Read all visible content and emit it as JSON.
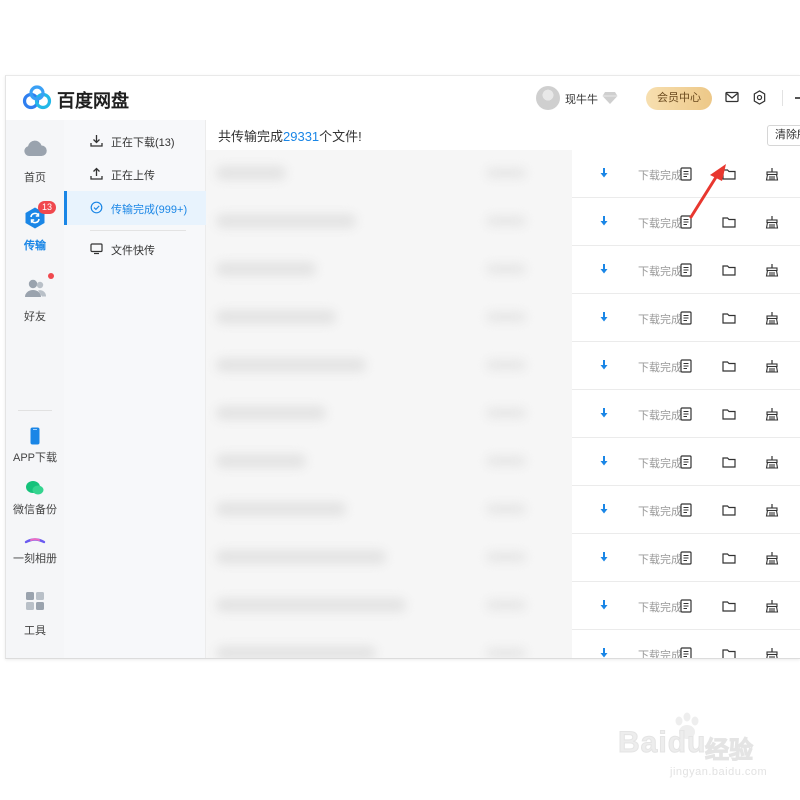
{
  "app": {
    "title": "百度网盘",
    "username": "现牛牛",
    "vip_button": "会员中心",
    "colors": {
      "accent": "#1a86e6",
      "badge": "#f0484e",
      "vip_gold": "#edc888"
    }
  },
  "nav": {
    "home": "首页",
    "transfer": "传输",
    "transfer_badge": "13",
    "friends": "好友",
    "app_download": "APP下载",
    "wechat_backup": "微信备份",
    "album": "一刻相册",
    "tools": "工具"
  },
  "subnav": {
    "downloading": "正在下载(13)",
    "uploading": "正在上传",
    "completed": "传输完成(999+)",
    "quick_send": "文件快传"
  },
  "main": {
    "summary_prefix": "共传输完成",
    "summary_count": "29331",
    "summary_suffix": "个文件!",
    "clear_button": "清除所",
    "rows": [
      {
        "status": "下载完成"
      },
      {
        "status": "下载完成"
      },
      {
        "status": "下载完成"
      },
      {
        "status": "下载完成"
      },
      {
        "status": "下载完成"
      },
      {
        "status": "下载完成"
      },
      {
        "status": "下载完成"
      },
      {
        "status": "下载完成"
      },
      {
        "status": "下载完成"
      },
      {
        "status": "下载完成"
      },
      {
        "status": "下载完成"
      }
    ]
  },
  "watermark": {
    "brand": "Bai",
    "brand2": "du",
    "jingyan": "经验",
    "url": "jingyan.baidu.com"
  },
  "icons": [
    "cloud-logo-icon",
    "home-cloud-icon",
    "transfer-icon",
    "friends-icon",
    "phone-icon",
    "wechat-icon",
    "album-icon",
    "tools-grid-icon",
    "download-icon",
    "upload-icon",
    "check-circle-icon",
    "monitor-icon",
    "doc-icon",
    "folder-icon",
    "clean-icon",
    "mail-icon",
    "settings-icon",
    "diamond-icon"
  ]
}
